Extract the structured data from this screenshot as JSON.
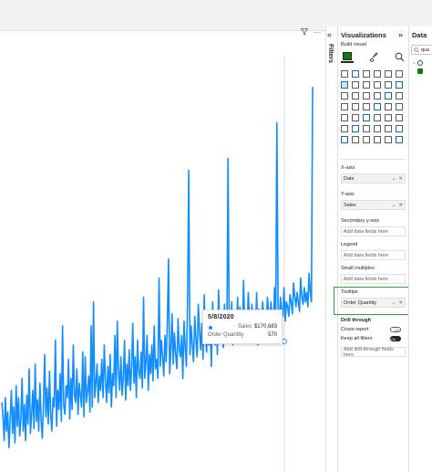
{
  "filters_pane": {
    "label": "Filters"
  },
  "visualizations_pane": {
    "title": "Visualizations",
    "build_visual_label": "Build visual",
    "wells": {
      "xaxis": {
        "title": "X-axis",
        "field": "Date"
      },
      "yaxis": {
        "title": "Y-axis",
        "field": "Sales"
      },
      "secondary_yaxis": {
        "title": "Secondary y-axis",
        "placeholder": "Add data fields here"
      },
      "legend": {
        "title": "Legend",
        "placeholder": "Add data fields here"
      },
      "small_multiples": {
        "title": "Small multiples",
        "placeholder": "Add data fields here"
      },
      "tooltips": {
        "title": "Tooltips",
        "field": "Order Quantity"
      }
    },
    "drill_through": {
      "title": "Drill through",
      "cross_report": {
        "label": "Cross-report",
        "state": "Off"
      },
      "keep_all_filters": {
        "label": "Keep all filters",
        "state": "On"
      },
      "placeholder": "Add drill-through fields here"
    }
  },
  "data_pane": {
    "title": "Data",
    "search_value": "qua"
  },
  "tooltip": {
    "date": "5/8/2020",
    "rows": [
      {
        "label": "Sales",
        "value": "$170,683"
      },
      {
        "label": "Order Quantity",
        "value": "570"
      }
    ]
  },
  "chart_data": {
    "type": "line",
    "color": "#118dff",
    "x_axis": "Date",
    "series": [
      {
        "name": "Sales",
        "values": [
          280,
          220,
          120,
          300,
          160,
          240,
          90,
          200,
          330,
          150,
          260,
          110,
          350,
          180,
          300,
          140,
          210,
          380,
          160,
          270,
          120,
          310,
          190,
          420,
          150,
          230,
          330,
          170,
          440,
          200,
          290,
          160,
          360,
          210,
          130,
          270,
          480,
          220,
          340,
          190,
          410,
          230,
          160,
          300,
          260,
          540,
          180,
          330,
          250,
          400,
          200,
          600,
          270,
          230,
          350,
          300,
          460,
          210,
          380,
          250,
          520,
          310,
          280,
          420,
          230,
          360,
          310,
          260,
          490,
          220,
          470,
          280,
          330,
          390,
          240,
          600,
          260,
          700,
          300,
          360,
          440,
          280,
          390,
          330,
          460,
          300,
          520,
          370,
          280,
          430,
          320,
          480,
          260,
          400,
          350,
          560,
          300,
          620,
          410,
          330,
          470,
          310,
          380,
          540,
          290,
          440,
          350,
          500,
          330,
          420,
          610,
          360,
          470,
          300,
          540,
          410,
          380,
          490,
          340,
          720,
          380,
          450,
          560,
          330,
          480,
          400,
          520,
          370,
          600,
          420,
          460,
          380,
          800,
          430,
          540,
          470,
          390,
          560,
          450,
          610,
          880,
          400,
          500,
          650,
          440,
          570,
          480,
          420,
          630,
          500,
          470,
          560,
          380,
          620,
          510,
          430,
          700,
          1250,
          480,
          600,
          520,
          450,
          640,
          540,
          470,
          690,
          580,
          500,
          610,
          460,
          730,
          560,
          490,
          640,
          520,
          600,
          430,
          700,
          580,
          520,
          660,
          480,
          750,
          590,
          540,
          620,
          510,
          690,
          570,
          530,
          1300,
          600,
          560,
          700,
          520,
          650,
          610,
          560,
          720,
          560,
          680,
          610,
          540,
          790,
          600,
          660,
          580,
          740,
          620,
          560,
          690,
          600,
          650,
          580,
          740,
          520,
          670,
          610,
          560,
          700,
          640,
          600,
          580,
          720,
          660,
          590,
          700,
          640,
          560,
          760,
          620,
          1450,
          680,
          600,
          720,
          660,
          640,
          760,
          620,
          700,
          680,
          640,
          730,
          700,
          650,
          780,
          720,
          680,
          740,
          700,
          660,
          800,
          720,
          690,
          760,
          700,
          740,
          680,
          820,
          740,
          700,
          1600
        ]
      }
    ]
  }
}
